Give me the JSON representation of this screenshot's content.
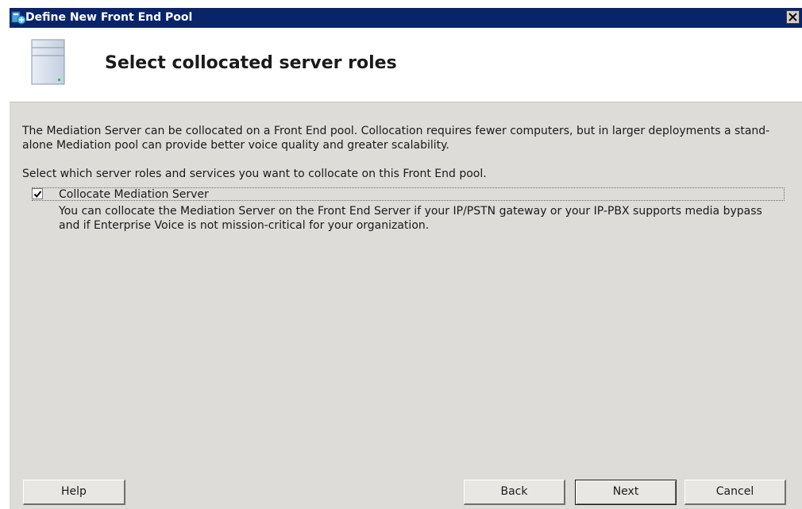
{
  "window": {
    "title": "Define New Front End Pool",
    "close_glyph": "✕"
  },
  "header": {
    "title": "Select collocated server roles",
    "icon": "server-icon"
  },
  "content": {
    "description": "The Mediation Server can be collocated on a Front End pool. Collocation requires fewer computers, but in larger deployments a stand-alone Mediation pool can provide better voice quality and greater scalability.",
    "prompt": "Select which server roles and services you want to collocate on this Front End pool.",
    "option": {
      "label": "Collocate Mediation Server",
      "checked": true,
      "description": "You can collocate the Mediation Server on the Front End Server if your IP/PSTN gateway or your IP-PBX supports media bypass and if Enterprise Voice is not mission-critical for your organization."
    }
  },
  "buttons": {
    "help": "Help",
    "back": "Back",
    "next": "Next",
    "cancel": "Cancel"
  },
  "colors": {
    "titlebar": "#0a246a",
    "dialog_bg": "#dedcd8",
    "header_bg": "#ffffff"
  }
}
